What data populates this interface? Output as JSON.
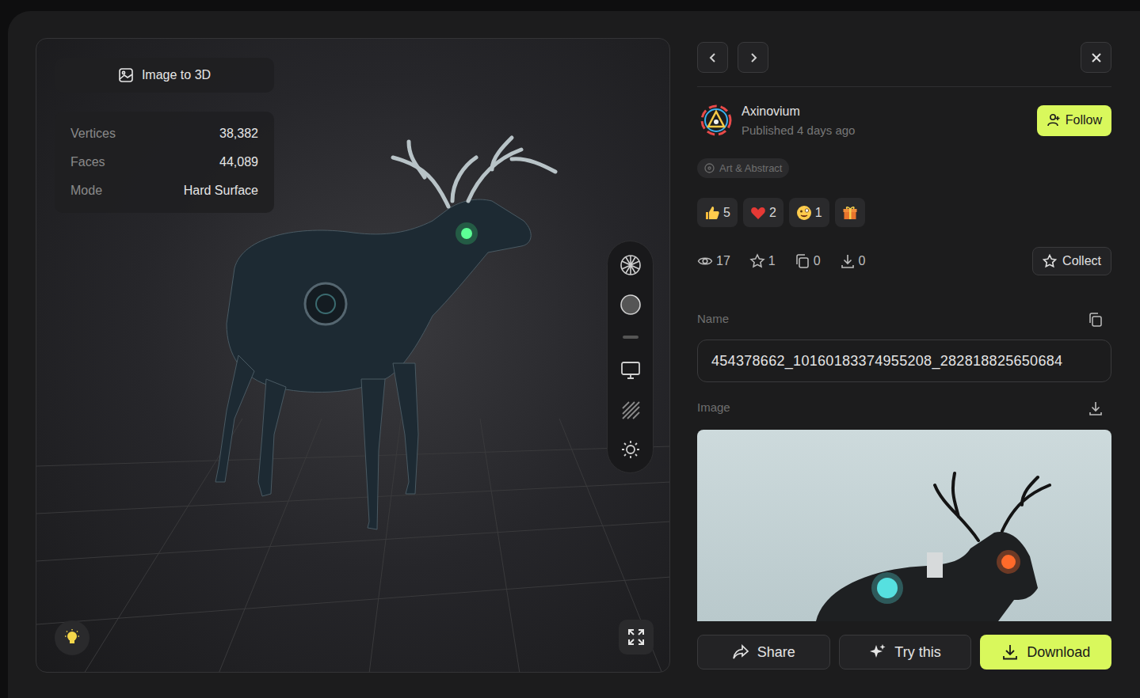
{
  "viewer": {
    "mode_badge": "Image to 3D",
    "stats": [
      {
        "label": "Vertices",
        "value": "38,382"
      },
      {
        "label": "Faces",
        "value": "44,089"
      },
      {
        "label": "Mode",
        "value": "Hard Surface"
      }
    ]
  },
  "author": {
    "name": "Axinovium",
    "published": "Published 4 days ago"
  },
  "follow_button": "Follow",
  "tag": "Art & Abstract",
  "reactions": [
    {
      "kind": "thumbs",
      "count": "5"
    },
    {
      "kind": "heart",
      "count": "2"
    },
    {
      "kind": "face",
      "count": "1"
    },
    {
      "kind": "gift"
    }
  ],
  "stats": [
    {
      "kind": "views",
      "value": "17"
    },
    {
      "kind": "stars",
      "value": "1"
    },
    {
      "kind": "copies",
      "value": "0"
    },
    {
      "kind": "downloads",
      "value": "0"
    }
  ],
  "collect_button": "Collect",
  "name_field": {
    "label": "Name",
    "value": "454378662_10160183374955208_282818825650684"
  },
  "image_section": {
    "label": "Image"
  },
  "actions": [
    {
      "label": "Share",
      "kind": "share",
      "primary": false
    },
    {
      "label": "Try this",
      "kind": "try",
      "primary": false
    },
    {
      "label": "Download",
      "kind": "download",
      "primary": true
    }
  ]
}
